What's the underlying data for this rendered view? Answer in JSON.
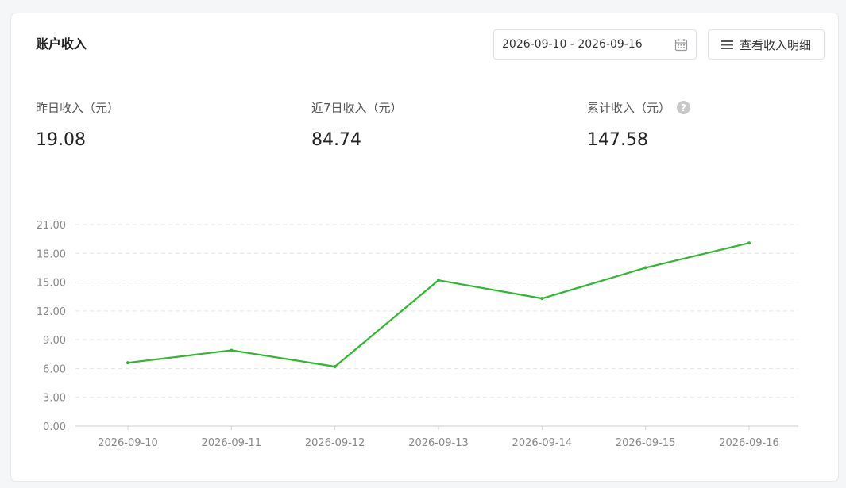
{
  "header": {
    "title": "账户收入",
    "date_range": "2026-09-10 - 2026-09-16",
    "detail_button": "查看收入明细"
  },
  "stats": [
    {
      "label": "昨日收入（元）",
      "value": "19.08"
    },
    {
      "label": "近7日收入（元）",
      "value": "84.74"
    },
    {
      "label": "累计收入（元）",
      "value": "147.58",
      "help": "?"
    }
  ],
  "colors": {
    "line": "#2db82d",
    "grid": "#e3e3e3",
    "axis_text": "#888888"
  },
  "icons": {
    "date": "calendar-icon",
    "detail": "list-icon",
    "help": "question-circle-icon"
  },
  "chart_data": {
    "type": "line",
    "x": [
      "2026-09-10",
      "2026-09-11",
      "2026-09-12",
      "2026-09-13",
      "2026-09-14",
      "2026-09-15",
      "2026-09-16"
    ],
    "series": [
      {
        "values": [
          6.6,
          7.9,
          6.2,
          15.2,
          13.3,
          16.5,
          19.08
        ]
      }
    ],
    "yticks": [
      "0.00",
      "3.00",
      "6.00",
      "9.00",
      "12.00",
      "15.00",
      "18.00",
      "21.00"
    ],
    "ylim": [
      0,
      21
    ],
    "grid": true,
    "title": "",
    "xlabel": "",
    "ylabel": ""
  }
}
